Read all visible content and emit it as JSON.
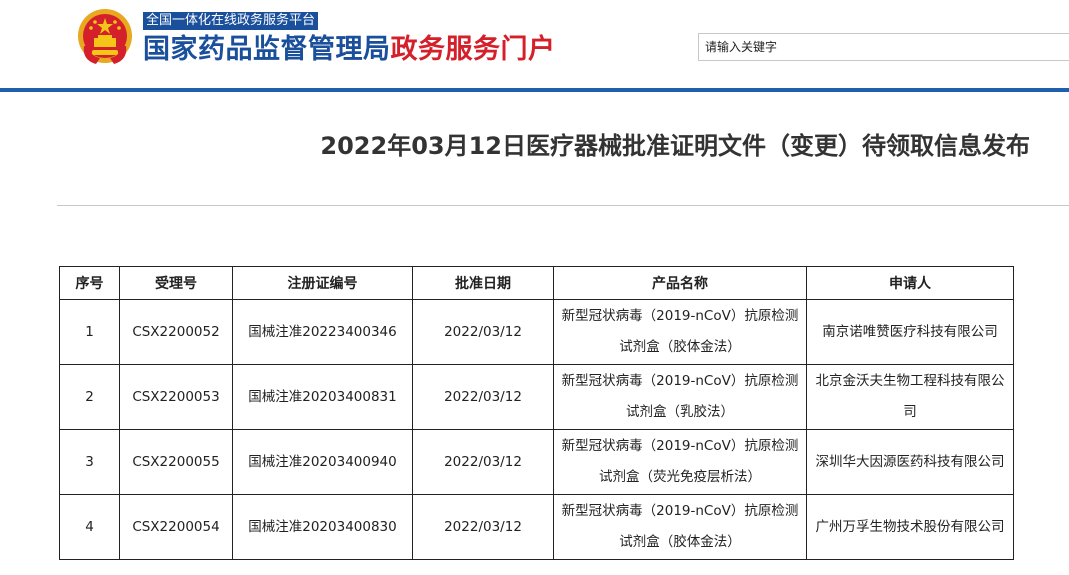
{
  "header": {
    "slogan": "全国一体化在线政务服务平台",
    "title_part1": "国家药品监督管理局",
    "title_part2": "政务服务门户",
    "emblem_icon": "national-emblem-icon",
    "brand_blue": "#1a4f9c",
    "brand_red": "#d4202a"
  },
  "search": {
    "placeholder": "请输入关键字"
  },
  "article": {
    "title": "2022年03月12日医疗器械批准证明文件（变更）待领取信息发布"
  },
  "table": {
    "headers": [
      "序号",
      "受理号",
      "注册证编号",
      "批准日期",
      "产品名称",
      "申请人"
    ],
    "rows": [
      [
        "1",
        "CSX2200052",
        "国械注准20223400346",
        "2022/03/12",
        "新型冠状病毒（2019-nCoV）抗原检测试剂盒（胶体金法）",
        "南京诺唯赞医疗科技有限公司"
      ],
      [
        "2",
        "CSX2200053",
        "国械注准20203400831",
        "2022/03/12",
        "新型冠状病毒（2019-nCoV）抗原检测试剂盒（乳胶法）",
        "北京金沃夫生物工程科技有限公司"
      ],
      [
        "3",
        "CSX2200055",
        "国械注准20203400940",
        "2022/03/12",
        "新型冠状病毒（2019-nCoV）抗原检测试剂盒（荧光免疫层析法）",
        "深圳华大因源医药科技有限公司"
      ],
      [
        "4",
        "CSX2200054",
        "国械注准20203400830",
        "2022/03/12",
        "新型冠状病毒（2019-nCoV）抗原检测试剂盒（胶体金法）",
        "广州万孚生物技术股份有限公司"
      ]
    ]
  }
}
